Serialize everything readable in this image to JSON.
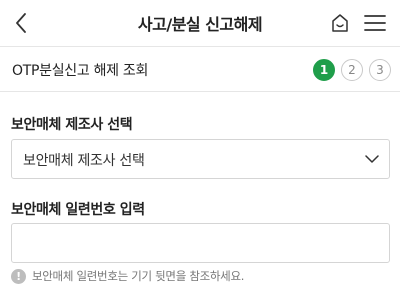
{
  "header": {
    "title": "사고/분실 신고해제",
    "back_icon": "chevron-left-icon",
    "home_icon": "home-icon",
    "menu_icon": "hamburger-menu-icon"
  },
  "subheader": {
    "title": "OTP분실신고 해제 조회",
    "steps": [
      "1",
      "2",
      "3"
    ],
    "active_step": 1,
    "active_color": "#1f9e4a"
  },
  "form": {
    "manufacturer": {
      "label": "보안매체 제조사 선택",
      "selected": "보안매체 제조사 선택"
    },
    "serial": {
      "label": "보안매체 일련번호 입력",
      "value": "",
      "hint": "보안매체 일련번호는 기기 뒷면을 참조하세요.",
      "hint_icon": "info-icon",
      "hint_icon_glyph": "!"
    }
  }
}
